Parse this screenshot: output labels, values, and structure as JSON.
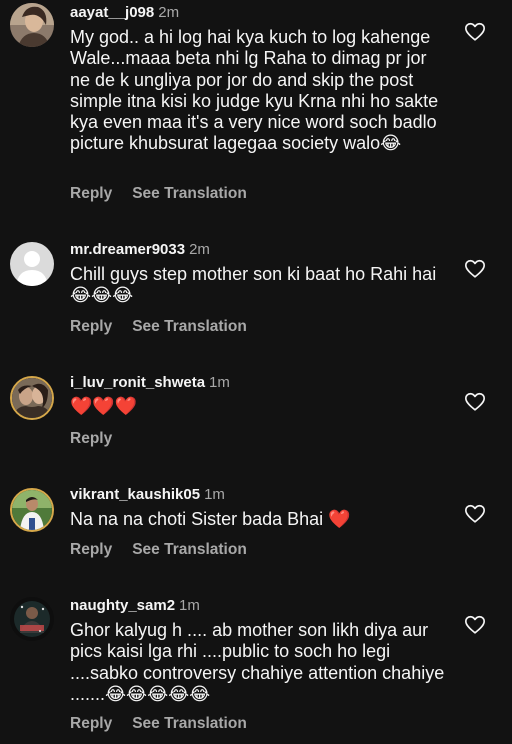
{
  "comments": [
    {
      "username": "aayat__j098",
      "time": "2m",
      "text": "My god.. a hi log hai kya kuch to log kahenge Wale...maaa beta nhi lg Raha to dimag pr jor ne de k ungliya por jor do and skip the post simple itna kisi ko judge kyu Krna nhi ho sakte kya even maa it's a very nice word soch badlo picture khubsurat lagegaa society walo😂",
      "reply": "Reply",
      "translate": "See Translation"
    },
    {
      "username": "mr.dreamer9033",
      "time": "2m",
      "text": "Chill guys step mother son ki baat ho Rahi hai😂😂😂",
      "reply": "Reply",
      "translate": "See Translation"
    },
    {
      "username": "i_luv_ronit_shweta",
      "time": "1m",
      "text": "❤️❤️❤️",
      "reply": "Reply"
    },
    {
      "username": "vikrant_kaushik05",
      "time": "1m",
      "text": "Na na na choti Sister bada Bhai ❤️",
      "reply": "Reply",
      "translate": "See Translation"
    },
    {
      "username": "naughty_sam2",
      "time": "1m",
      "text": "Ghor kalyug h .... ab mother son likh diya aur pics kaisi lga rhi ....public to soch ho legi ....sabko controversy chahiye attention chahiye .......😂😂😂😂😂",
      "reply": "Reply",
      "translate": "See Translation"
    }
  ],
  "icons": {
    "like": "heart-outline-icon",
    "default_avatar": "person-silhouette-icon"
  },
  "colors": {
    "background": "#121212",
    "primary_text": "#f5f5f5",
    "secondary_text": "#a8a8a8"
  }
}
